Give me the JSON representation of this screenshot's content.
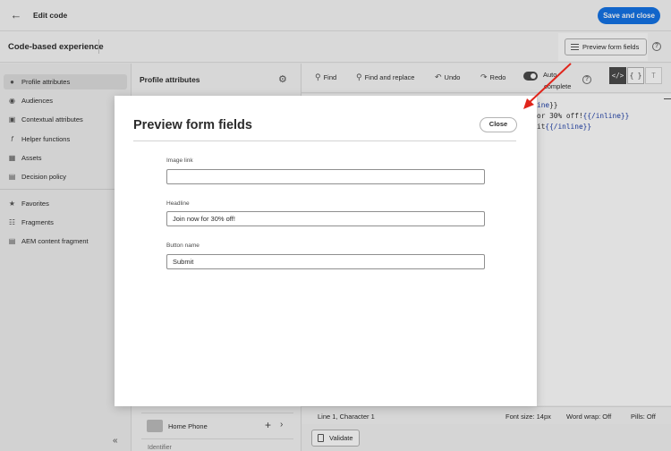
{
  "topbar": {
    "back_icon": "arrow-left-icon",
    "title": "Edit code",
    "save_label": "Save and close",
    "accent": "#1473e6"
  },
  "subbar": {
    "title": "Code-based experience",
    "preview_label": "Preview form fields",
    "help_icon": "help-circle-icon"
  },
  "leftnav": {
    "items": [
      {
        "label": "Profile attributes",
        "icon": "user-icon"
      },
      {
        "label": "Audiences",
        "icon": "audiences-icon"
      },
      {
        "label": "Contextual attributes",
        "icon": "contextual-icon"
      },
      {
        "label": "Helper functions",
        "icon": "function-icon"
      },
      {
        "label": "Assets",
        "icon": "image-icon"
      },
      {
        "label": "Decision policy",
        "icon": "decision-icon"
      },
      {
        "label": "Favorites",
        "icon": "star-icon"
      },
      {
        "label": "Fragments",
        "icon": "fragments-icon"
      },
      {
        "label": "AEM content fragment",
        "icon": "aem-icon"
      }
    ],
    "collapse_icon": "double-chevron-left-icon"
  },
  "midpanel": {
    "title": "Profile attributes",
    "gear_icon": "gear-icon",
    "row_label": "Home Phone",
    "identifier": "Identifier"
  },
  "toolbar": {
    "find": "Find",
    "find_replace": "Find and replace",
    "undo": "Undo",
    "redo": "Redo",
    "auto": "Auto",
    "complete": "complete",
    "mode_code": "</>",
    "mode_json": "{ }",
    "mode_text": "T"
  },
  "code": {
    "line1_tail": "ine",
    "line1_close": "}}",
    "line2_text": "or 30% off!",
    "line2_tag": "{{/inline}}",
    "line3_text": "it",
    "line3_tag": "{{/inline}}"
  },
  "status": {
    "position": "Line 1, Character 1",
    "font_size": "Font size: 14px",
    "word_wrap": "Word wrap: Off",
    "pills": "Pills: Off",
    "validate": "Validate"
  },
  "modal": {
    "title": "Preview form fields",
    "close_label": "Close",
    "fields": [
      {
        "label": "Image link",
        "value": ""
      },
      {
        "label": "Headline",
        "value": "Join now for 30% off!"
      },
      {
        "label": "Button name",
        "value": "Submit"
      }
    ]
  }
}
